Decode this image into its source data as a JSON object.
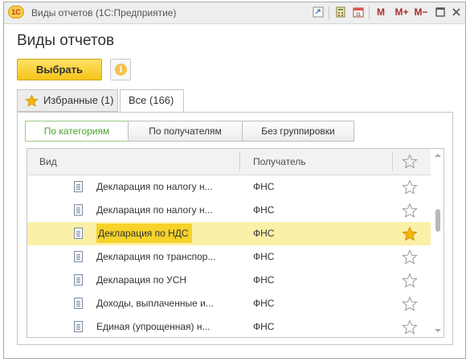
{
  "window": {
    "title": "Виды отчетов  (1С:Предприятие)",
    "logo_text": "1С",
    "buttons": {
      "m": "M",
      "m_plus": "M+",
      "m_minus": "M−"
    }
  },
  "page_title": "Виды отчетов",
  "toolbar": {
    "select_label": "Выбрать",
    "info_glyph": "i"
  },
  "tabs": [
    {
      "label": "Избранные (1)",
      "icon": "star-icon"
    },
    {
      "label": "Все (166)"
    }
  ],
  "grouping": {
    "options": [
      "По категориям",
      "По получателям",
      "Без группировки"
    ],
    "active": "По категориям"
  },
  "table": {
    "columns": [
      "Вид",
      "Получатель"
    ],
    "rows": [
      {
        "name": "Декларация по налогу н...",
        "recipient": "ФНС",
        "favorite": false
      },
      {
        "name": "Декларация по налогу н...",
        "recipient": "ФНС",
        "favorite": false
      },
      {
        "name": "Декларация по НДС",
        "recipient": "ФНС",
        "favorite": true
      },
      {
        "name": "Декларация по транспор...",
        "recipient": "ФНС",
        "favorite": false
      },
      {
        "name": "Декларация по УСН",
        "recipient": "ФНС",
        "favorite": false
      },
      {
        "name": "Доходы, выплаченные и...",
        "recipient": "ФНС",
        "favorite": false
      },
      {
        "name": "Единая (упрощенная) н...",
        "recipient": "ФНС",
        "favorite": false
      }
    ],
    "selected_index": 2
  },
  "colors": {
    "accent_yellow": "#f5c518",
    "selected_row": "#fbf0a8",
    "active_green": "#4aa32b",
    "star_filled": "#f2b705"
  }
}
